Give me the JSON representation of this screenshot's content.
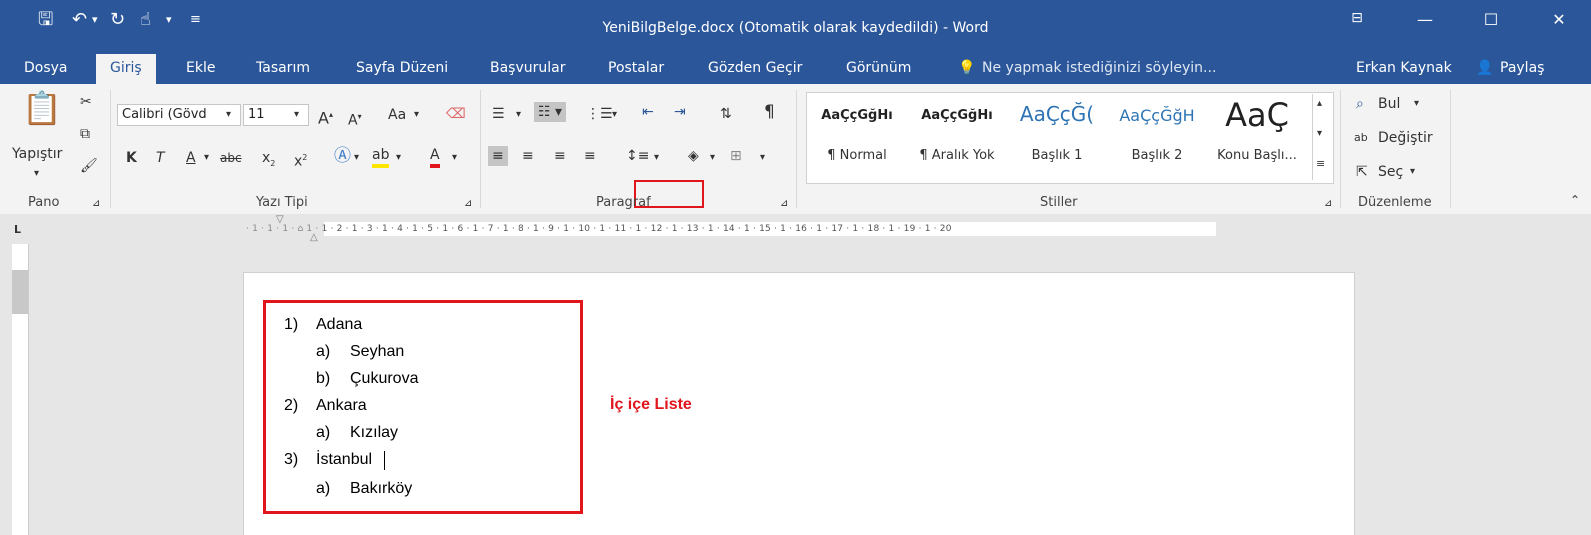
{
  "window": {
    "title": "YeniBilgBelge.docx (Otomatik olarak kaydedildi) - Word",
    "quick_access": [
      "save-icon",
      "undo-icon",
      "redo-icon",
      "touch-mode-icon",
      "customize-icon"
    ],
    "controls": [
      "ribbon-display-icon",
      "minimize-icon",
      "maximize-icon",
      "close-icon"
    ]
  },
  "tabs": [
    "Dosya",
    "Giriş",
    "Ekle",
    "Tasarım",
    "Sayfa Düzeni",
    "Başvurular",
    "Postalar",
    "Gözden Geçir",
    "Görünüm"
  ],
  "active_tab": "Giriş",
  "tell_me": "Ne yapmak istediğinizi söyleyin...",
  "user": "Erkan Kaynak",
  "share": "Paylaş",
  "ribbon": {
    "clipboard": {
      "label": "Pano",
      "paste": "Yapıştır"
    },
    "font": {
      "label": "Yazı Tipi",
      "family": "Calibri (Gövd",
      "size": "11",
      "change_case": "Aa",
      "bold": "K",
      "italic": "T",
      "underline": "A",
      "strike": "abc"
    },
    "paragraph": {
      "label": "Paragraf"
    },
    "styles": {
      "label": "Stiller",
      "items": [
        {
          "sample": "AaÇçĞğHı",
          "name": "¶ Normal"
        },
        {
          "sample": "AaÇçĞğHı",
          "name": "¶ Aralık Yok"
        },
        {
          "sample": "AaÇçĞ(",
          "name": "Başlık 1"
        },
        {
          "sample": "AaÇçĞğH",
          "name": "Başlık 2"
        },
        {
          "sample": "AaÇ",
          "name": "Konu Başlı..."
        }
      ]
    },
    "editing": {
      "label": "Düzenleme",
      "find": "Bul",
      "replace": "Değiştir",
      "select": "Seç"
    }
  },
  "ruler_text": "· 1 · 1 · 1 · ⌂ 1 · 1 · 2 · 1 · 3 · 1 · 4 · 1 · 5 · 1 · 6 · 1 · 7 · 1 · 8 · 1 · 9 · 1 · 10 · 1 · 11 · 1 · 12 · 1 · 13 · 1 · 14 · 1 · 15 · 1 · 16 · 1 · 17 · 1 · 18 · 1 · 19 · 1 · 20",
  "document": {
    "list": [
      {
        "num": "1)",
        "text": "Adana",
        "level": 0
      },
      {
        "num": "a)",
        "text": "Seyhan",
        "level": 1
      },
      {
        "num": "b)",
        "text": "Çukurova",
        "level": 1
      },
      {
        "num": "2)",
        "text": "Ankara",
        "level": 0
      },
      {
        "num": "a)",
        "text": "Kızılay",
        "level": 1
      },
      {
        "num": "3)",
        "text": "İstanbul",
        "level": 0
      },
      {
        "num": "a)",
        "text": "Bakırköy",
        "level": 1
      }
    ],
    "annotation": "İç içe Liste"
  },
  "colors": {
    "brand": "#2b579a",
    "highlight": "#e0161c"
  }
}
